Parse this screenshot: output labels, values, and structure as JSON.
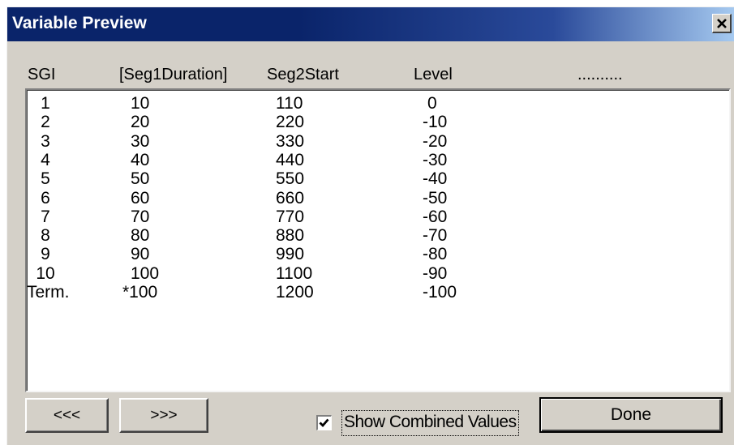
{
  "window": {
    "title": "Variable Preview",
    "close_glyph": "✕"
  },
  "table": {
    "headers": [
      "SGI",
      "[Seg1Duration]",
      "Seg2Start",
      "Level",
      ".........."
    ],
    "rows": [
      [
        "1",
        "10",
        "110",
        "0"
      ],
      [
        "2",
        "20",
        "220",
        "-10"
      ],
      [
        "3",
        "30",
        "330",
        "-20"
      ],
      [
        "4",
        "40",
        "440",
        "-30"
      ],
      [
        "5",
        "50",
        "550",
        "-40"
      ],
      [
        "6",
        "60",
        "660",
        "-50"
      ],
      [
        "7",
        "70",
        "770",
        "-60"
      ],
      [
        "8",
        "80",
        "880",
        "-70"
      ],
      [
        "9",
        "90",
        "990",
        "-80"
      ],
      [
        "10",
        "100",
        "1100",
        "-90"
      ],
      [
        "Term.",
        "*100",
        "1200",
        "-100"
      ]
    ]
  },
  "buttons": {
    "prev_label": "<<<",
    "next_label": ">>>",
    "done_label": "Done"
  },
  "checkbox": {
    "label": "Show Combined Values",
    "checked": true
  },
  "colors": {
    "title_bar": "#0a246a",
    "face": "#d4d0c8"
  }
}
